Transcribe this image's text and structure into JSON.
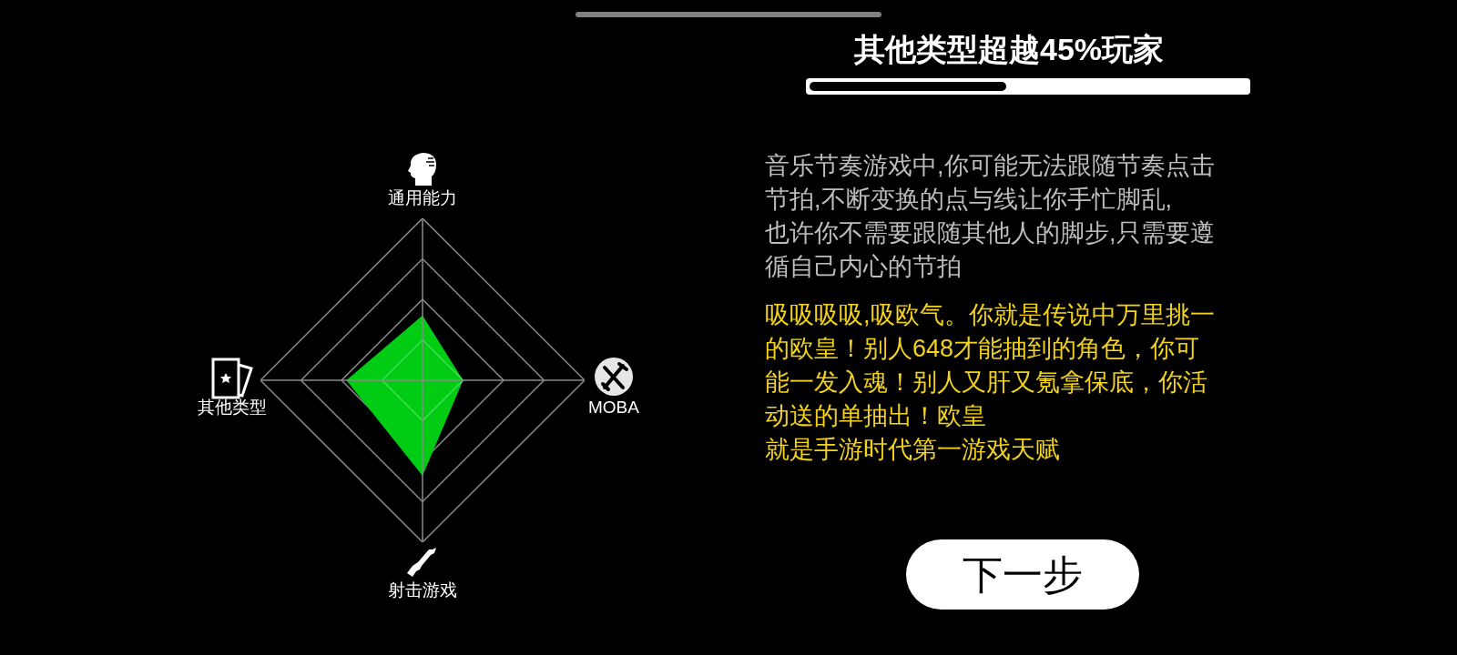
{
  "radar": {
    "axes": [
      {
        "label": "通用能力",
        "kind": "head"
      },
      {
        "label": "其他类型",
        "kind": "card"
      },
      {
        "label": "MOBA",
        "kind": "swords"
      },
      {
        "label": "射击游戏",
        "kind": "gun"
      }
    ]
  },
  "title": "其他类型超越45%玩家",
  "progress": {
    "level": 0.45
  },
  "description_lines": [
    "音乐节奏游戏中,你可能无法跟随节奏点击",
    "节拍,不断变换的点与线让你手忙脚乱,",
    "也许你不需要跟随其他人的脚步,只需要遵",
    "循自己内心的节拍"
  ],
  "verdict_lines": [
    "吸吸吸吸,吸欧气。你就是传说中万里挑一",
    "的欧皇！别人648才能抽到的角色，你可",
    "能一发入魂！别人又肝又氪拿保底，你活",
    "动送的单抽出！欧皇",
    "就是手游时代第一游戏天赋"
  ],
  "next_button": "下一步"
}
